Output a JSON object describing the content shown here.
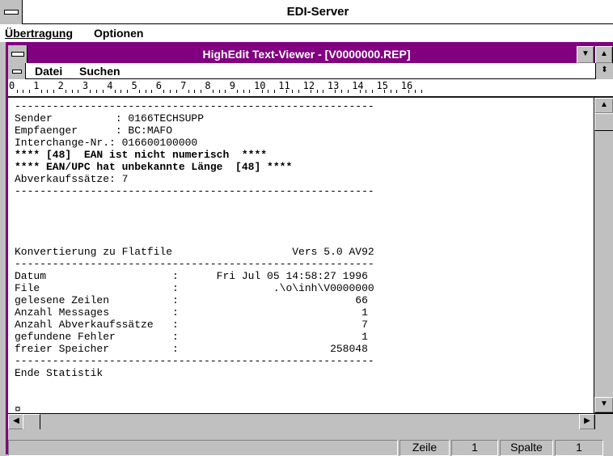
{
  "outer_window": {
    "title": "EDI-Server",
    "menu": [
      "Übertragung",
      "Optionen"
    ]
  },
  "inner_window": {
    "title": "HighEdit Text-Viewer - [V0000000.REP]",
    "menu": [
      "Datei",
      "Suchen"
    ]
  },
  "ruler": {
    "labels": [
      "0",
      "1",
      "2",
      "3",
      "4",
      "5",
      "6",
      "7",
      "8",
      "9",
      "10",
      "11",
      "12",
      "13",
      "14",
      "15",
      "16"
    ]
  },
  "document": {
    "lines": [
      {
        "text": "---------------------------------------------------------",
        "bold": false
      },
      {
        "text": "Sender          : 0166TECHSUPP",
        "bold": false
      },
      {
        "text": "Empfaenger      : BC:MAFO",
        "bold": false
      },
      {
        "text": "Interchange-Nr.: 016600100000",
        "bold": false
      },
      {
        "text": "**** [48]  EAN ist nicht numerisch  ****",
        "bold": true
      },
      {
        "text": "**** EAN/UPC hat unbekannte Länge  [48] ****",
        "bold": true
      },
      {
        "text": "Abverkaufssätze: 7",
        "bold": false
      },
      {
        "text": "---------------------------------------------------------",
        "bold": false
      },
      {
        "text": "",
        "bold": false
      },
      {
        "text": "",
        "bold": false
      },
      {
        "text": "",
        "bold": false
      },
      {
        "text": "",
        "bold": false
      },
      {
        "text": "Konvertierung zu Flatfile                   Vers 5.0 AV92",
        "bold": false
      },
      {
        "text": "---------------------------------------------------------",
        "bold": false
      },
      {
        "text": "Datum                    :      Fri Jul 05 14:58:27 1996",
        "bold": false
      },
      {
        "text": "File                     :               .\\o\\inh\\V0000000",
        "bold": false
      },
      {
        "text": "gelesene Zeilen          :                            66",
        "bold": false
      },
      {
        "text": "Anzahl Messages          :                             1",
        "bold": false
      },
      {
        "text": "Anzahl Abverkaufssätze   :                             7",
        "bold": false
      },
      {
        "text": "gefundene Fehler         :                             1",
        "bold": false
      },
      {
        "text": "freier Speicher          :                        258048",
        "bold": false
      },
      {
        "text": "---------------------------------------------------------",
        "bold": false
      },
      {
        "text": "Ende Statistik",
        "bold": false
      },
      {
        "text": "",
        "bold": false
      },
      {
        "text": "",
        "bold": false
      },
      {
        "text": "¤",
        "bold": false
      }
    ]
  },
  "status": {
    "line_label": "Zeile",
    "line_value": "1",
    "column_label": "Spalte",
    "column_value": "1"
  },
  "icons": {
    "minimize": "down-arrow-icon",
    "maximize": "up-arrow-icon",
    "restore": "up-down-arrow-icon"
  }
}
